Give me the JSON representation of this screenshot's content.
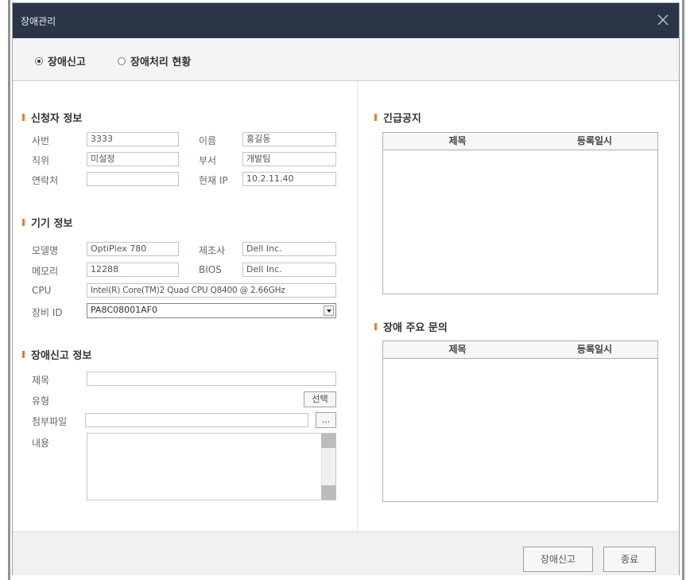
{
  "window": {
    "title": "장애관리"
  },
  "modes": {
    "report": "장애신고",
    "status": "장애처리 현황",
    "selected": "report"
  },
  "requester": {
    "title": "신청자 정보",
    "emp_no_label": "사번",
    "emp_no": "3333",
    "name_label": "이름",
    "name": "홍길동",
    "position_label": "직위",
    "position": "미설정",
    "dept_label": "부서",
    "dept": "개발팀",
    "contact_label": "연락처",
    "contact": "",
    "ip_label": "현재 IP",
    "ip": "10.2.11.40"
  },
  "device": {
    "title": "기기 정보",
    "model_label": "모델명",
    "model": "OptiPlex 780",
    "maker_label": "제조사",
    "maker": "Dell Inc.",
    "memory_label": "메모리",
    "memory": "12288",
    "bios_label": "BIOS",
    "bios": "Dell Inc.",
    "cpu_label": "CPU",
    "cpu": "Intel(R) Core(TM)2 Quad CPU   Q8400  @ 2.66GHz",
    "device_id_label": "장비 ID",
    "device_id": "PA8C08001AF0"
  },
  "report": {
    "title": "장애신고 정보",
    "subject_label": "제목",
    "subject": "",
    "type_label": "유형",
    "type_button": "선택",
    "attach_label": "첨부파일",
    "attach": "",
    "browse_button": "...",
    "content_label": "내용",
    "content": ""
  },
  "notice": {
    "title": "긴급공지",
    "col_subject": "제목",
    "col_date": "등록일시"
  },
  "faq": {
    "title": "장애 주요 문의",
    "col_subject": "제목",
    "col_date": "등록일시"
  },
  "footer": {
    "submit": "장애신고",
    "close": "종료"
  },
  "colors": {
    "titlebar": "#2b3548",
    "accent": "#ef7a2e"
  }
}
